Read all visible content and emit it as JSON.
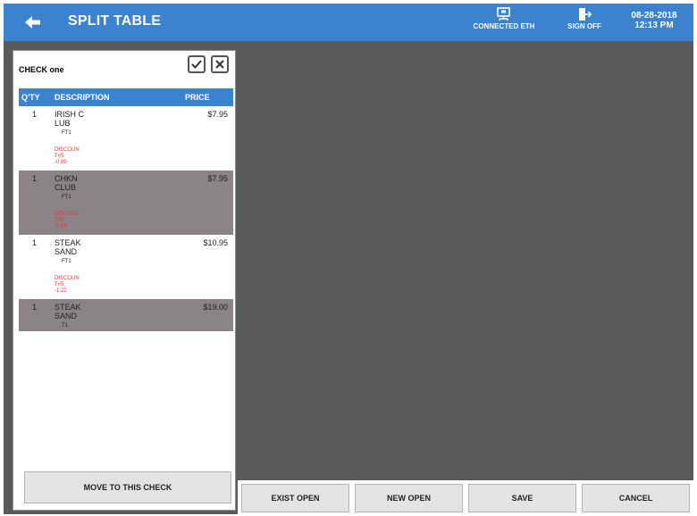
{
  "header": {
    "title": "SPLIT TABLE",
    "connection_label": "CONNECTED ETH",
    "signoff_label": "SIGN OFF",
    "date": "08-28-2018",
    "time": "12:13 PM",
    "bar_color": "#3b83cf"
  },
  "check": {
    "name": "CHECK one",
    "columns": {
      "qty": "Q'TY",
      "description": "DESCRIPTION",
      "price": "PRICE"
    },
    "items": [
      {
        "qty": "1",
        "desc1": "IRISH C",
        "desc2": "LUB",
        "tax": "FT1",
        "price": "$7.95",
        "selected": false,
        "discount": [
          "DISCOUN",
          "T#5",
          "-0.89"
        ]
      },
      {
        "qty": "1",
        "desc1": "CHKN",
        "desc2": "CLUB",
        "tax": "FT1",
        "price": "$7.95",
        "selected": true,
        "discount": [
          "DISCOUN",
          "T#5",
          "-0.89"
        ]
      },
      {
        "qty": "1",
        "desc1": "STEAK",
        "desc2": "SAND",
        "tax": "FT1",
        "price": "$10.95",
        "selected": false,
        "discount": [
          "DISCOUN",
          "T#5",
          "-1.22"
        ]
      },
      {
        "qty": "1",
        "desc1": "STEAK",
        "desc2": "SAND",
        "tax": "T1",
        "price": "$19.00",
        "selected": true,
        "discount": []
      }
    ],
    "move_button": "MOVE TO THIS CHECK"
  },
  "actions": {
    "exist_open": "EXIST OPEN",
    "new_open": "NEW OPEN",
    "save": "SAVE",
    "cancel": "CANCEL"
  },
  "colors": {
    "discount": "#e53935",
    "selected_row": "#8a8383",
    "background": "#5a5a5a"
  }
}
